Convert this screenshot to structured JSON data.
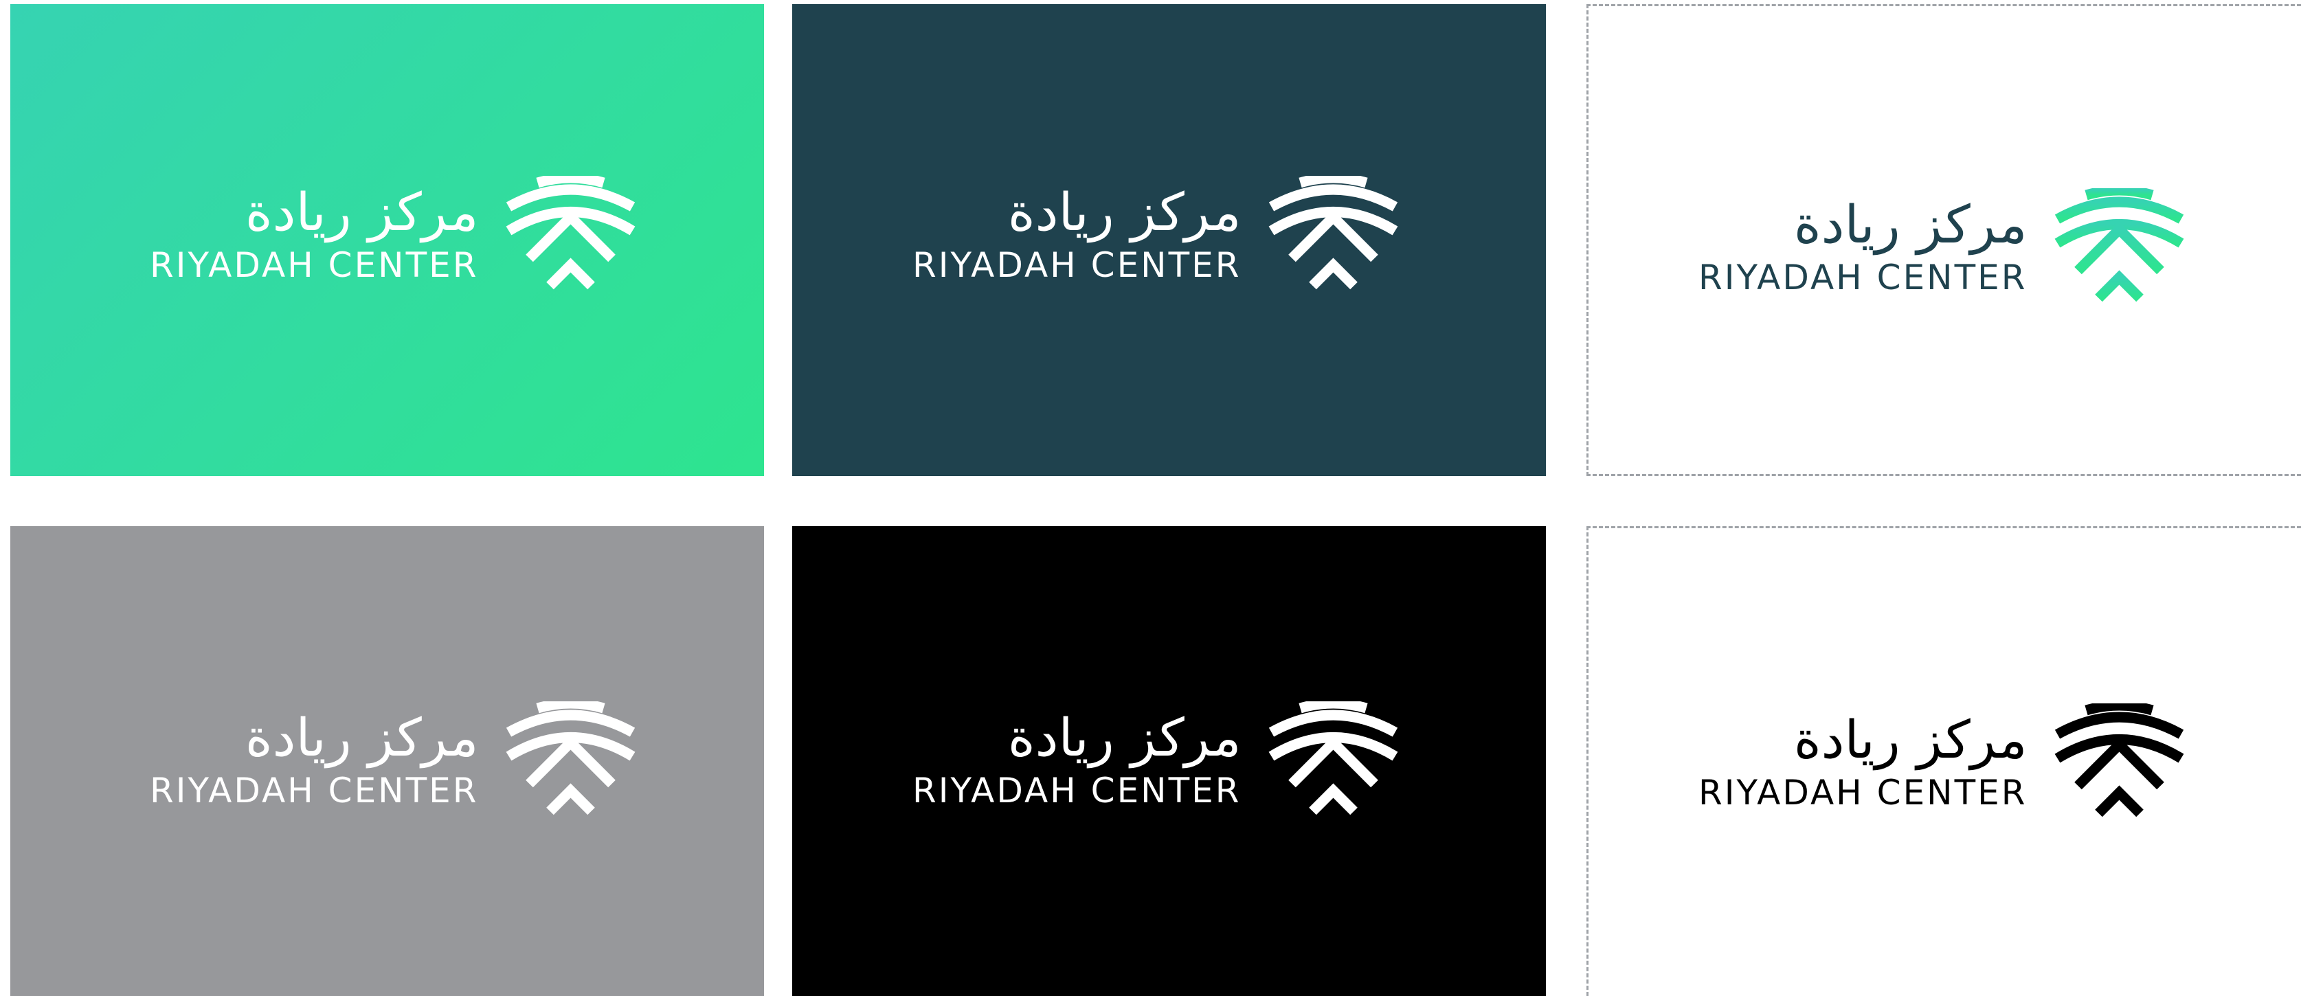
{
  "brand": {
    "arabic_name": "مركز ريادة",
    "english_name": "RIYADAH CENTER"
  },
  "variants": [
    {
      "name": "gradient-green",
      "background": [
        "#36d3b2",
        "#2ee48f"
      ],
      "text_color": "#ffffff",
      "mark_color": "#ffffff"
    },
    {
      "name": "dark-teal",
      "background": "#1f424e",
      "text_color": "#ffffff",
      "mark_color": "#ffffff"
    },
    {
      "name": "white-color",
      "background": "#ffffff",
      "text_color": "#1f424e",
      "mark_colors": [
        "#36d3b2",
        "#2ee48f"
      ],
      "dashed_border": true
    },
    {
      "name": "gray",
      "background": "#97989b",
      "text_color": "#ffffff",
      "mark_color": "#ffffff"
    },
    {
      "name": "black",
      "background": "#000000",
      "text_color": "#ffffff",
      "mark_color": "#ffffff"
    },
    {
      "name": "white-black",
      "background": "#ffffff",
      "text_color": "#000000",
      "mark_color": "#000000",
      "dashed_border": true
    }
  ],
  "icons": {
    "mark": "riyadah-chevron-mark-icon"
  }
}
